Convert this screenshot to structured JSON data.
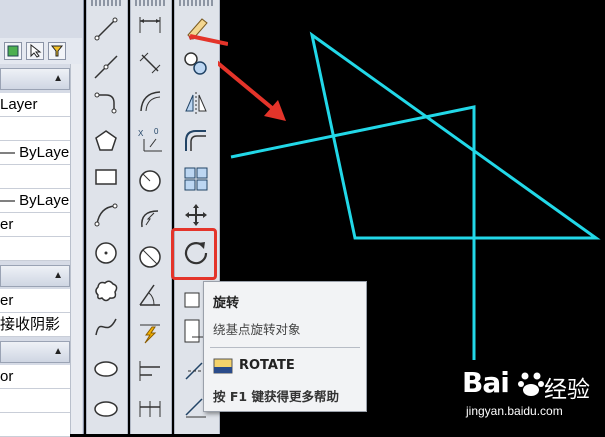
{
  "properties": {
    "rows": [
      "Layer",
      "",
      "— ByLayer",
      "",
      "— ByLayer",
      "er",
      "",
      "er",
      "接收阴影",
      "",
      "or",
      "",
      ""
    ],
    "section_arrow": "▲"
  },
  "tooltip": {
    "title": "旋转",
    "description": "绕基点旋转对象",
    "command": "ROTATE",
    "help": "按 F1 键获得更多帮助"
  },
  "watermark": {
    "brand": "Bai",
    "brand_suffix": "经验",
    "url": "jingyan.baidu.com"
  },
  "colors": {
    "canvas": "#000000",
    "geometry": "#22d8e8",
    "highlight": "#e4342a"
  },
  "icons": {
    "draw_toolbar": [
      "line-icon",
      "construction-line-icon",
      "polyline-icon",
      "polygon-icon",
      "rectangle-icon",
      "arc-icon",
      "circle-icon",
      "revision-cloud-icon",
      "spline-icon",
      "ellipse-icon",
      "ellipse-arc-icon"
    ],
    "dimension_toolbar": [
      "linear-dim-icon",
      "aligned-dim-icon",
      "arc-length-dim-icon",
      "ordinate-dim-icon",
      "radius-dim-icon",
      "jogged-dim-icon",
      "diameter-dim-icon",
      "angular-dim-icon",
      "quick-dim-icon",
      "baseline-dim-icon",
      "continue-dim-icon"
    ],
    "modify_toolbar": [
      "erase-icon",
      "copy-icon",
      "mirror-icon",
      "offset-icon",
      "array-icon",
      "move-icon",
      "rotate-icon",
      "scale-icon",
      "stretch-icon",
      "trim-icon"
    ]
  }
}
